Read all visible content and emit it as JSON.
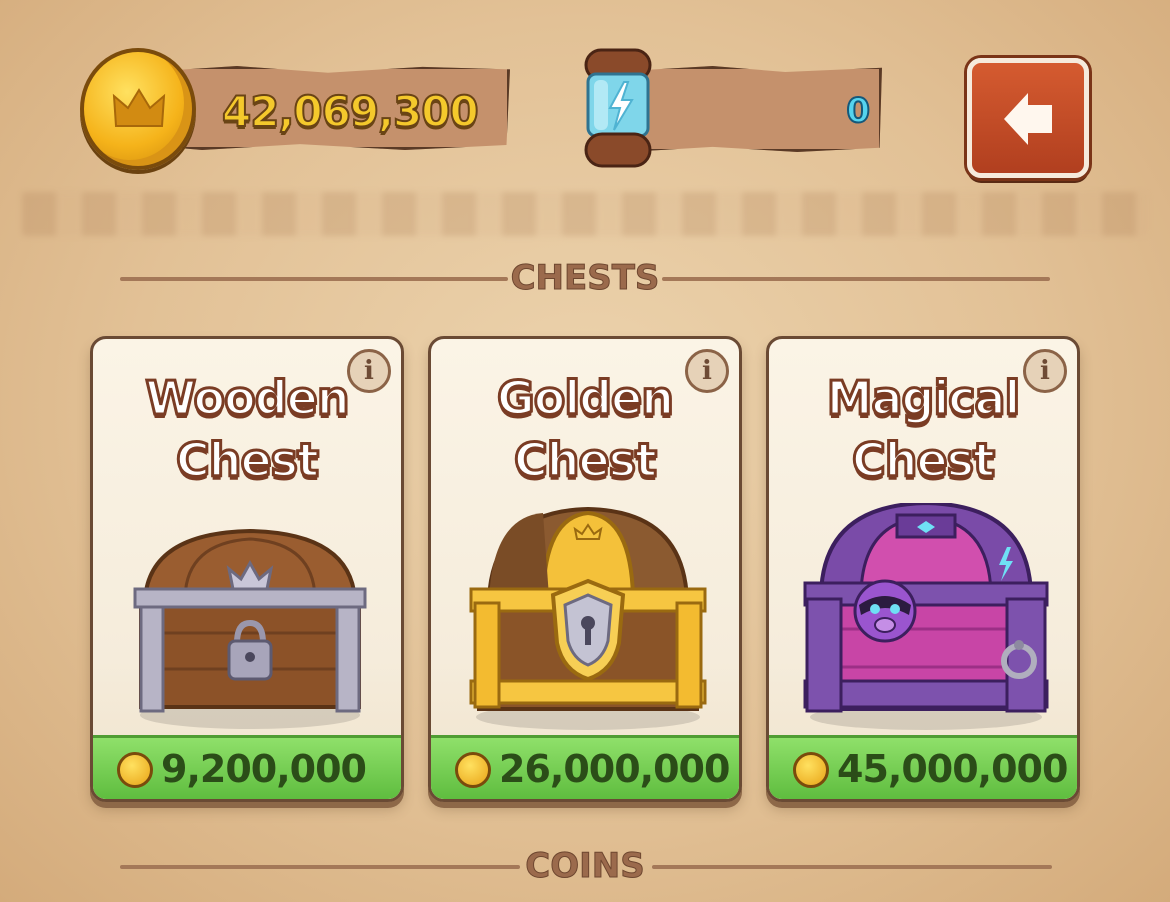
{
  "header": {
    "coins": "42,069,300",
    "spins": "0"
  },
  "sections": {
    "chests_title": "CHESTS",
    "coins_title": "COINS"
  },
  "chests": [
    {
      "name_line1": "Wooden",
      "name_line2": "Chest",
      "price": "9,200,000",
      "info": "i"
    },
    {
      "name_line1": "Golden",
      "name_line2": "Chest",
      "price": "26,000,000",
      "info": "i"
    },
    {
      "name_line1": "Magical",
      "name_line2": "Chest",
      "price": "45,000,000",
      "info": "i"
    }
  ],
  "icons": {
    "coin": "coin-icon",
    "spin": "energy-capsule-icon",
    "back": "back-arrow-icon",
    "info": "info-icon"
  },
  "colors": {
    "price_bar": "#6cc84a",
    "back_button": "#c54d28",
    "coin_gold": "#f4c92c",
    "spin_blue": "#55d4ee"
  }
}
